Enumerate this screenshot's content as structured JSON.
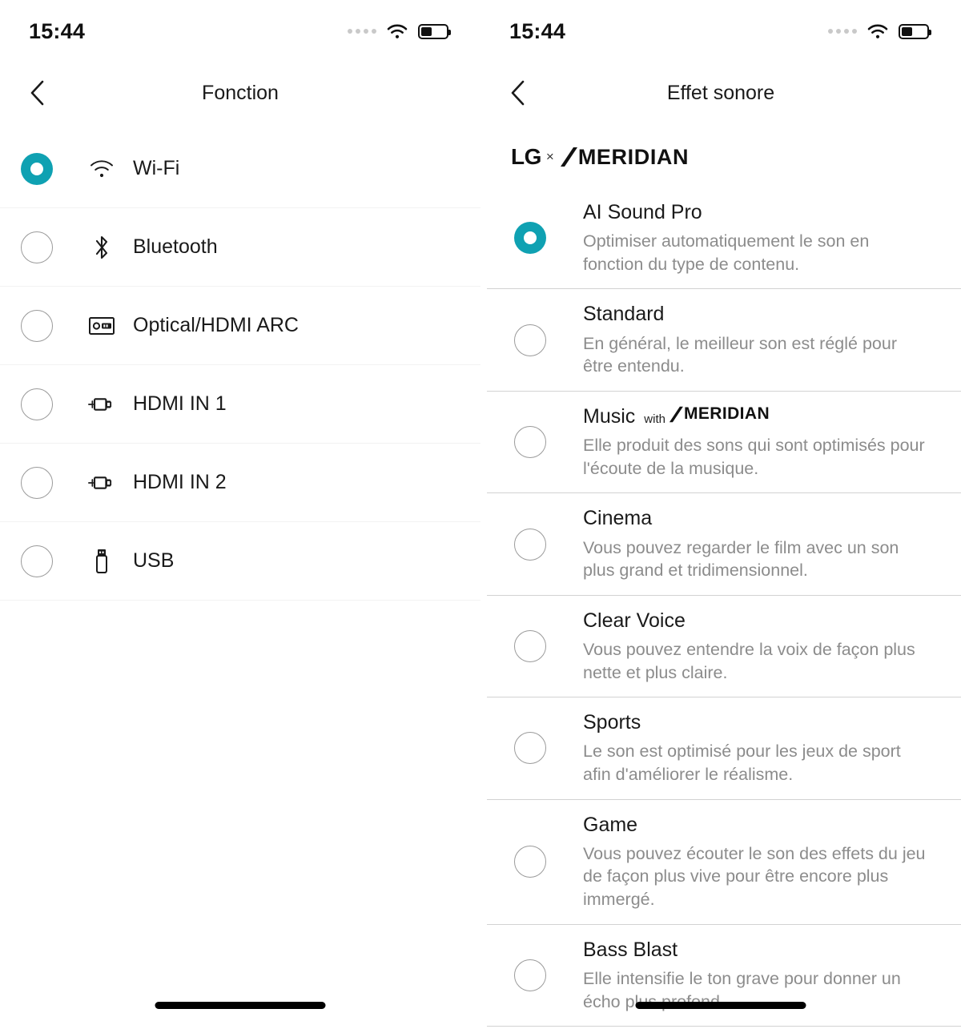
{
  "theme": {
    "accent": "#0fa1b2",
    "text": "#1a1a1a",
    "muted": "#8c8c8c",
    "divider_light": "#f2f2f2",
    "divider": "#d2d2d2"
  },
  "status_bar": {
    "time": "15:44",
    "wifi_icon": "wifi-icon",
    "battery_icon": "battery-icon",
    "battery_level_percent": 40,
    "signal_dots": 4
  },
  "left_screen": {
    "nav": {
      "back_icon": "chevron-left-icon",
      "title": "Fonction"
    },
    "items": [
      {
        "label": "Wi-Fi",
        "icon": "wifi-icon",
        "selected": true
      },
      {
        "label": "Bluetooth",
        "icon": "bluetooth-icon",
        "selected": false
      },
      {
        "label": "Optical/HDMI ARC",
        "icon": "optical-arc-icon",
        "selected": false
      },
      {
        "label": "HDMI IN 1",
        "icon": "hdmi-plug-icon",
        "selected": false
      },
      {
        "label": "HDMI IN 2",
        "icon": "hdmi-plug-icon",
        "selected": false
      },
      {
        "label": "USB",
        "icon": "usb-drive-icon",
        "selected": false
      }
    ]
  },
  "right_screen": {
    "nav": {
      "back_icon": "chevron-left-icon",
      "title": "Effet sonore"
    },
    "brand": {
      "lg": "LG",
      "x": "×",
      "meridian": "MERIDIAN"
    },
    "items": [
      {
        "title": "AI Sound Pro",
        "desc": "Optimiser automatiquement le son en fonction du type de contenu.",
        "selected": true,
        "with_label": "",
        "with_brand": ""
      },
      {
        "title": "Standard",
        "desc": "En général, le meilleur son est réglé pour être entendu.",
        "selected": false,
        "with_label": "",
        "with_brand": ""
      },
      {
        "title": "Music",
        "desc": "Elle produit des sons qui sont optimisés pour l'écoute de la musique.",
        "selected": false,
        "with_label": "with",
        "with_brand": "MERIDIAN"
      },
      {
        "title": "Cinema",
        "desc": "Vous pouvez regarder le film avec un son plus grand et tridimensionnel.",
        "selected": false,
        "with_label": "",
        "with_brand": ""
      },
      {
        "title": "Clear Voice",
        "desc": "Vous pouvez entendre la voix de façon plus nette et plus claire.",
        "selected": false,
        "with_label": "",
        "with_brand": ""
      },
      {
        "title": "Sports",
        "desc": "Le son est optimisé pour les jeux de sport afin d'améliorer le réalisme.",
        "selected": false,
        "with_label": "",
        "with_brand": ""
      },
      {
        "title": "Game",
        "desc": "Vous pouvez écouter le son des effets du jeu de façon plus vive pour être encore plus immergé.",
        "selected": false,
        "with_label": "",
        "with_brand": ""
      },
      {
        "title": "Bass Blast",
        "desc": "Elle intensifie le ton grave pour donner un écho plus profond.",
        "selected": false,
        "with_label": "",
        "with_brand": ""
      }
    ]
  }
}
